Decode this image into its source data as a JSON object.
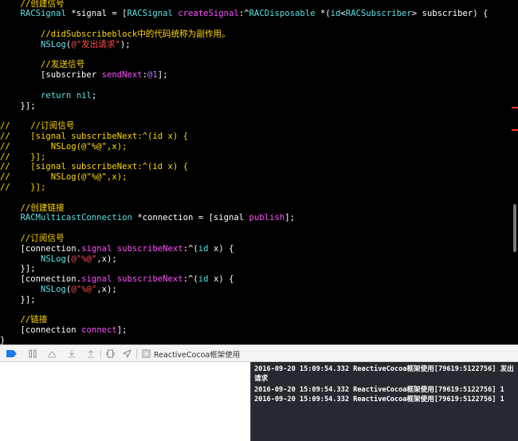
{
  "editor": {
    "lines": [
      [
        {
          "t": "    ",
          "c": "plain"
        },
        {
          "t": "//创建信号",
          "c": "comment"
        }
      ],
      [
        {
          "t": "    ",
          "c": "plain"
        },
        {
          "t": "RACSignal",
          "c": "type"
        },
        {
          "t": " *signal = [",
          "c": "plain"
        },
        {
          "t": "RACSignal",
          "c": "type"
        },
        {
          "t": " ",
          "c": "plain"
        },
        {
          "t": "createSignal",
          "c": "method"
        },
        {
          "t": ":^",
          "c": "plain"
        },
        {
          "t": "RACDisposable",
          "c": "type"
        },
        {
          "t": " *(",
          "c": "plain"
        },
        {
          "t": "id",
          "c": "keyword"
        },
        {
          "t": "<",
          "c": "plain"
        },
        {
          "t": "RACSubscriber",
          "c": "type"
        },
        {
          "t": "> subscriber) {",
          "c": "plain"
        }
      ],
      [
        {
          "t": "",
          "c": "plain"
        }
      ],
      [
        {
          "t": "        ",
          "c": "plain"
        },
        {
          "t": "//didSubscribeblock中的代码统称为副作用。",
          "c": "comment"
        }
      ],
      [
        {
          "t": "        ",
          "c": "plain"
        },
        {
          "t": "NSLog",
          "c": "type"
        },
        {
          "t": "(",
          "c": "plain"
        },
        {
          "t": "@\"发出请求\"",
          "c": "string"
        },
        {
          "t": ");",
          "c": "plain"
        }
      ],
      [
        {
          "t": "",
          "c": "plain"
        }
      ],
      [
        {
          "t": "        ",
          "c": "plain"
        },
        {
          "t": "//发送信号",
          "c": "comment"
        }
      ],
      [
        {
          "t": "        [subscriber ",
          "c": "plain"
        },
        {
          "t": "sendNext",
          "c": "method"
        },
        {
          "t": ":",
          "c": "plain"
        },
        {
          "t": "@1",
          "c": "number"
        },
        {
          "t": "];",
          "c": "plain"
        }
      ],
      [
        {
          "t": "",
          "c": "plain"
        }
      ],
      [
        {
          "t": "        ",
          "c": "plain"
        },
        {
          "t": "return",
          "c": "keyword"
        },
        {
          "t": " ",
          "c": "plain"
        },
        {
          "t": "nil",
          "c": "keyword"
        },
        {
          "t": ";",
          "c": "plain"
        }
      ],
      [
        {
          "t": "    }];",
          "c": "plain"
        }
      ],
      [
        {
          "t": "",
          "c": "plain"
        }
      ],
      [
        {
          "t": "//    //订阅信号",
          "c": "cmtcode"
        }
      ],
      [
        {
          "t": "//    [signal subscribeNext:^(id x) {",
          "c": "cmtcode"
        }
      ],
      [
        {
          "t": "//        NSLog(@\"%@\",x);",
          "c": "cmtcode"
        }
      ],
      [
        {
          "t": "//    }];",
          "c": "cmtcode"
        }
      ],
      [
        {
          "t": "//    [signal subscribeNext:^(id x) {",
          "c": "cmtcode"
        }
      ],
      [
        {
          "t": "//        NSLog(@\"%@\",x);",
          "c": "cmtcode"
        }
      ],
      [
        {
          "t": "//    }];",
          "c": "cmtcode"
        }
      ],
      [
        {
          "t": "",
          "c": "plain"
        }
      ],
      [
        {
          "t": "    ",
          "c": "plain"
        },
        {
          "t": "//创建链接",
          "c": "comment"
        }
      ],
      [
        {
          "t": "    ",
          "c": "plain"
        },
        {
          "t": "RACMulticastConnection",
          "c": "type"
        },
        {
          "t": " *connection = [signal ",
          "c": "plain"
        },
        {
          "t": "publish",
          "c": "method"
        },
        {
          "t": "];",
          "c": "plain"
        }
      ],
      [
        {
          "t": "",
          "c": "plain"
        }
      ],
      [
        {
          "t": "    ",
          "c": "plain"
        },
        {
          "t": "//订阅信号",
          "c": "comment"
        }
      ],
      [
        {
          "t": "    [connection.",
          "c": "plain"
        },
        {
          "t": "signal",
          "c": "method"
        },
        {
          "t": " ",
          "c": "plain"
        },
        {
          "t": "subscribeNext",
          "c": "method"
        },
        {
          "t": ":^(",
          "c": "plain"
        },
        {
          "t": "id",
          "c": "keyword"
        },
        {
          "t": " x) {",
          "c": "plain"
        }
      ],
      [
        {
          "t": "        ",
          "c": "plain"
        },
        {
          "t": "NSLog",
          "c": "type"
        },
        {
          "t": "(",
          "c": "plain"
        },
        {
          "t": "@\"%@\"",
          "c": "string"
        },
        {
          "t": ",x);",
          "c": "plain"
        }
      ],
      [
        {
          "t": "    }];",
          "c": "plain"
        }
      ],
      [
        {
          "t": "    [connection.",
          "c": "plain"
        },
        {
          "t": "signal",
          "c": "method"
        },
        {
          "t": " ",
          "c": "plain"
        },
        {
          "t": "subscribeNext",
          "c": "method"
        },
        {
          "t": ":^(",
          "c": "plain"
        },
        {
          "t": "id",
          "c": "keyword"
        },
        {
          "t": " x) {",
          "c": "plain"
        }
      ],
      [
        {
          "t": "        ",
          "c": "plain"
        },
        {
          "t": "NSLog",
          "c": "type"
        },
        {
          "t": "(",
          "c": "plain"
        },
        {
          "t": "@\"%@\"",
          "c": "string"
        },
        {
          "t": ",x);",
          "c": "plain"
        }
      ],
      [
        {
          "t": "    }];",
          "c": "plain"
        }
      ],
      [
        {
          "t": "",
          "c": "plain"
        }
      ],
      [
        {
          "t": "    ",
          "c": "plain"
        },
        {
          "t": "//链接",
          "c": "comment"
        }
      ],
      [
        {
          "t": "    [connection ",
          "c": "plain"
        },
        {
          "t": "connect",
          "c": "method"
        },
        {
          "t": "];",
          "c": "plain"
        }
      ],
      [
        {
          "t": "}",
          "c": "plain"
        }
      ]
    ]
  },
  "debug_bar": {
    "icons": [
      "breakpoints-toggle-icon",
      "pause-icon",
      "step-over-icon",
      "step-into-icon",
      "step-out-icon",
      "view-debugger-icon",
      "location-icon",
      "target-icon"
    ],
    "crumb": "ReactiveCocoa框架使用"
  },
  "console": {
    "lines": [
      "2016-09-20 15:09:54.332 ReactiveCocoa框架使用[79619:5122756] 发出请求",
      "2016-09-20 15:09:54.332 ReactiveCocoa框架使用[79619:5122756] 1",
      "2016-09-20 15:09:54.332 ReactiveCocoa框架使用[79619:5122756] 1"
    ]
  },
  "colors": {
    "editor_bg": "#000000",
    "comment": "#ffd700",
    "type": "#5ce1e6",
    "method": "#ff4fff",
    "string": "#ff4b4b",
    "console_bg": "#262a30"
  }
}
